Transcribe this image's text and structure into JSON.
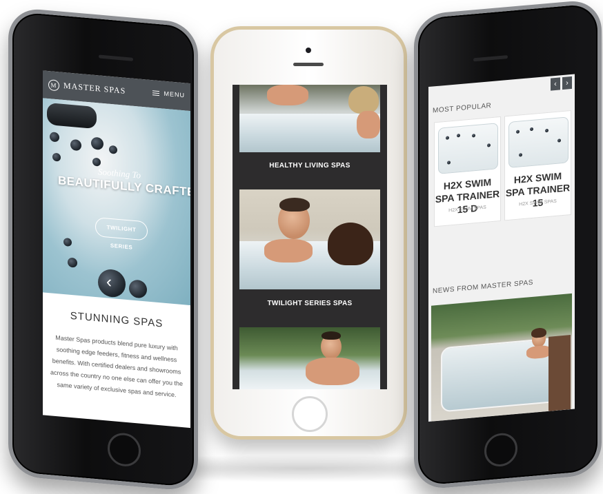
{
  "left_phone": {
    "logo": "MASTER SPAS",
    "logo_mark": "M",
    "menu_label": "MENU",
    "hero_kicker": "Soothing To",
    "hero_title": "BEAUTIFULLY CRAFTED SPAS",
    "hero_button": "TWILIGHT SERIES",
    "section_title": "STUNNING SPAS",
    "section_body": "Master Spas products blend pure luxury with soothing edge feeders, fitness and wellness benefits. With certified dealers and showrooms across the country no one else can offer you the same variety of exclusive spas and service."
  },
  "center_phone": {
    "cards": [
      {
        "label": "HEALTHY LIVING SPAS"
      },
      {
        "label": "TWILIGHT SERIES SPAS"
      },
      {
        "label": ""
      }
    ]
  },
  "right_phone": {
    "most_popular_title": "MOST POPULAR",
    "prev_icon": "‹",
    "next_icon": "›",
    "products": [
      {
        "name": "H2X SWIM SPA TRAINER 15 D",
        "category": "H2X SWIM SPAS"
      },
      {
        "name": "H2X SWIM SPA TRAINER 15",
        "category": "H2X SWIM SPAS"
      }
    ],
    "news_title": "NEWS FROM MASTER SPAS"
  },
  "colors": {
    "header": "#4d5257",
    "center_bg": "#2d2c2d",
    "water": "#9cc3d0"
  }
}
